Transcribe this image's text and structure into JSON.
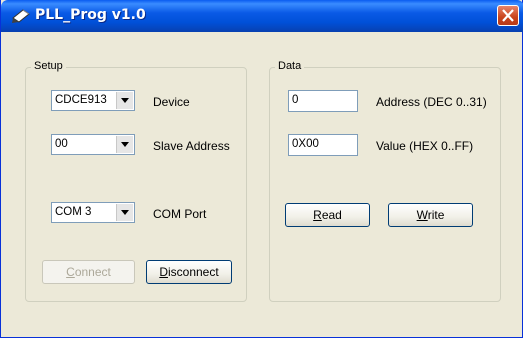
{
  "window": {
    "title": "PLL_Prog v1.0"
  },
  "setup": {
    "legend": "Setup",
    "device": {
      "value": "CDCE913",
      "label": "Device"
    },
    "slave_address": {
      "value": "00",
      "label": "Slave Address"
    },
    "com_port": {
      "value": "COM 3",
      "label": "COM Port"
    },
    "connect": {
      "key": "C",
      "rest": "onnect"
    },
    "disconnect": {
      "key": "D",
      "rest": "isconnect"
    }
  },
  "data": {
    "legend": "Data",
    "address": {
      "value": "0",
      "label": "Address (DEC 0..31)"
    },
    "value": {
      "value": "0X00",
      "label": "Value (HEX 0..FF)"
    },
    "read": {
      "key": "R",
      "rest": "ead"
    },
    "write": {
      "key": "W",
      "rest": "rite"
    }
  },
  "colors": {
    "titlebar": "#0a5ae6",
    "window_bg": "#ece9d8",
    "close": "#c8441c"
  }
}
